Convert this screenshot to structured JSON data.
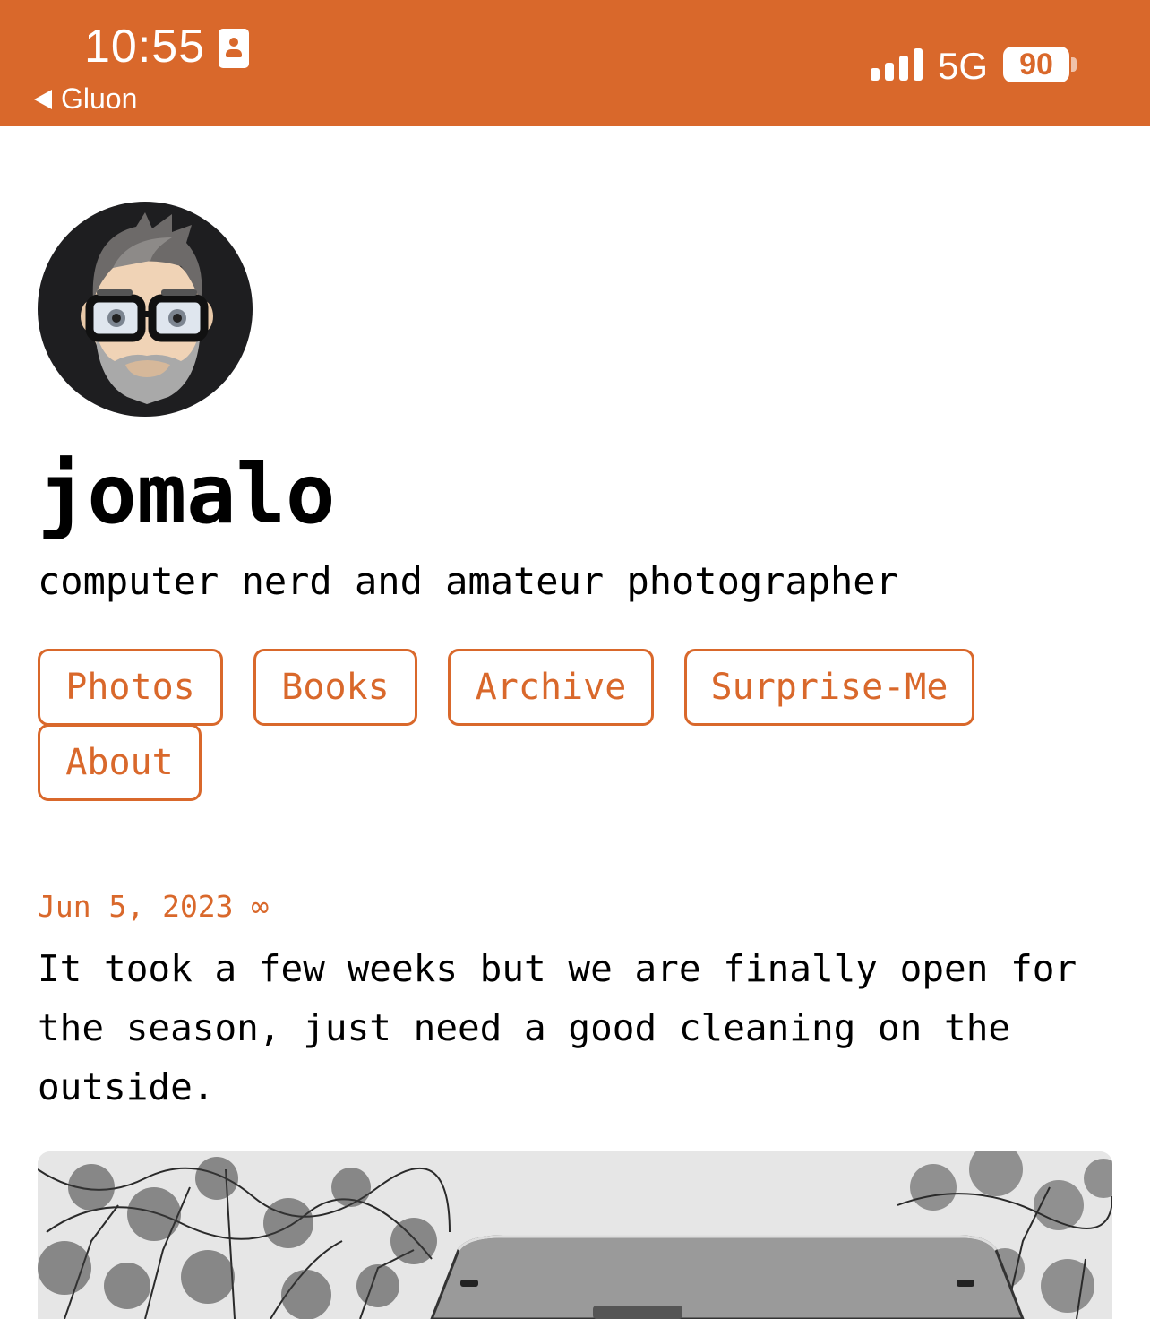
{
  "status_bar": {
    "time": "10:55",
    "back_label": "Gluon",
    "network": "5G",
    "battery": "90",
    "background_color": "#d9682b"
  },
  "profile": {
    "avatar_icon": "memoji-avatar",
    "name": "jomalo",
    "tagline": "computer nerd and amateur photographer"
  },
  "nav": {
    "accent_color": "#d9682b",
    "items": [
      "Photos",
      "Books",
      "Archive",
      "Surprise-Me",
      "About"
    ]
  },
  "post": {
    "date": "Jun 5, 2023 ∞",
    "text": "It took a few weeks but we are finally open for the season, just need a good cleaning on the outside.",
    "image_icon": "photo-black-white-trailer"
  }
}
